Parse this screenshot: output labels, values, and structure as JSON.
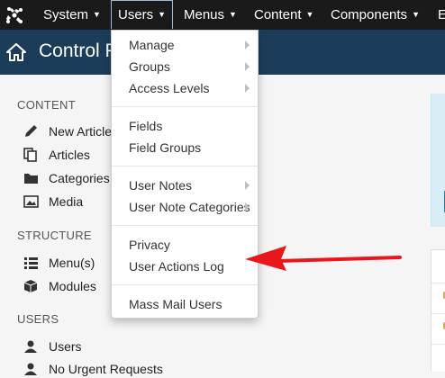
{
  "navbar": {
    "items": [
      {
        "label": "System"
      },
      {
        "label": "Users"
      },
      {
        "label": "Menus"
      },
      {
        "label": "Content"
      },
      {
        "label": "Components"
      },
      {
        "label": "E"
      }
    ]
  },
  "header": {
    "title": "Control P"
  },
  "sidebar": {
    "content_title": "CONTENT",
    "content_items": [
      {
        "label": "New Article",
        "icon": "pencil-icon"
      },
      {
        "label": "Articles",
        "icon": "copy-icon"
      },
      {
        "label": "Categories",
        "icon": "folder-icon"
      },
      {
        "label": "Media",
        "icon": "image-icon"
      }
    ],
    "structure_title": "STRUCTURE",
    "structure_items": [
      {
        "label": "Menu(s)",
        "icon": "list-icon"
      },
      {
        "label": "Modules",
        "icon": "cube-icon"
      }
    ],
    "users_title": "USERS",
    "users_items": [
      {
        "label": "Users",
        "icon": "user-icon"
      },
      {
        "label": "No Urgent Requests",
        "icon": "user-icon"
      }
    ]
  },
  "dropdown": {
    "items": [
      {
        "label": "Manage",
        "submenu": true
      },
      {
        "label": "Groups",
        "submenu": true
      },
      {
        "label": "Access Levels",
        "submenu": true
      },
      {
        "label": "Fields",
        "submenu": false
      },
      {
        "label": "Field Groups",
        "submenu": false
      },
      {
        "label": "User Notes",
        "submenu": true
      },
      {
        "label": "User Note Categories",
        "submenu": true
      },
      {
        "label": "Privacy",
        "submenu": false
      },
      {
        "label": "User Actions Log",
        "submenu": false
      },
      {
        "label": "Mass Mail Users",
        "submenu": false
      }
    ]
  },
  "colors": {
    "navbar_bg": "#1a1a1a",
    "header_bg": "#1c3d5a",
    "annotation_arrow": "#e8171c"
  }
}
